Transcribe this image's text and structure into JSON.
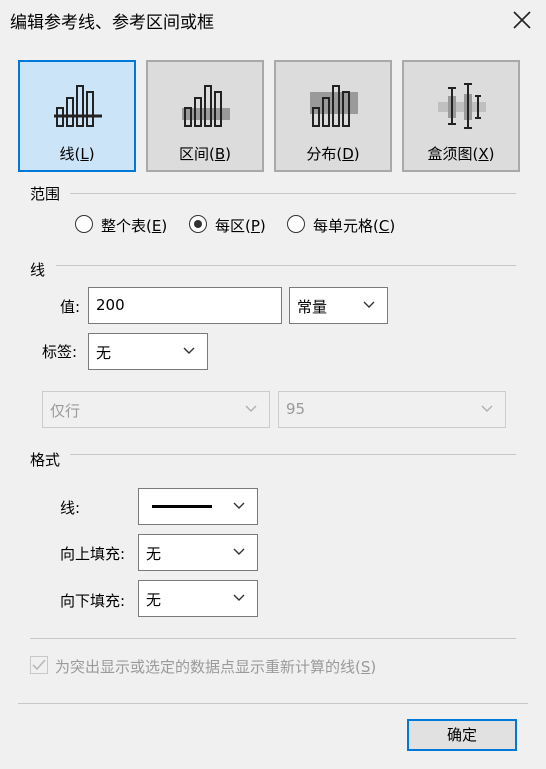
{
  "window": {
    "title": "编辑参考线、参考区间或框"
  },
  "types": [
    {
      "name": "线",
      "key": "L",
      "selected": true
    },
    {
      "name": "区间",
      "key": "B",
      "selected": false
    },
    {
      "name": "分布",
      "key": "D",
      "selected": false
    },
    {
      "name": "盒须图",
      "key": "X",
      "selected": false
    }
  ],
  "scope": {
    "heading": "范围",
    "options": [
      {
        "name": "整个表",
        "key": "E",
        "selected": false
      },
      {
        "name": "每区",
        "key": "P",
        "selected": true
      },
      {
        "name": "每单元格",
        "key": "C",
        "selected": false
      }
    ]
  },
  "line": {
    "heading": "线",
    "value_label": "值:",
    "value": "200",
    "value_type": "常量",
    "label_label": "标签:",
    "label_value": "无",
    "disabled_left": "仅行",
    "disabled_right": "95"
  },
  "format": {
    "heading": "格式",
    "line_label": "线:",
    "fill_above_label": "向上填充:",
    "fill_above": "无",
    "fill_below_label": "向下填充:",
    "fill_below": "无"
  },
  "recalc": {
    "text": "为突出显示或选定的数据点显示重新计算的线",
    "key": "S",
    "checked": true
  },
  "ok_label": "确定",
  "colors": {
    "accent": "#0078d7",
    "selected_bg": "#cce4f7"
  }
}
